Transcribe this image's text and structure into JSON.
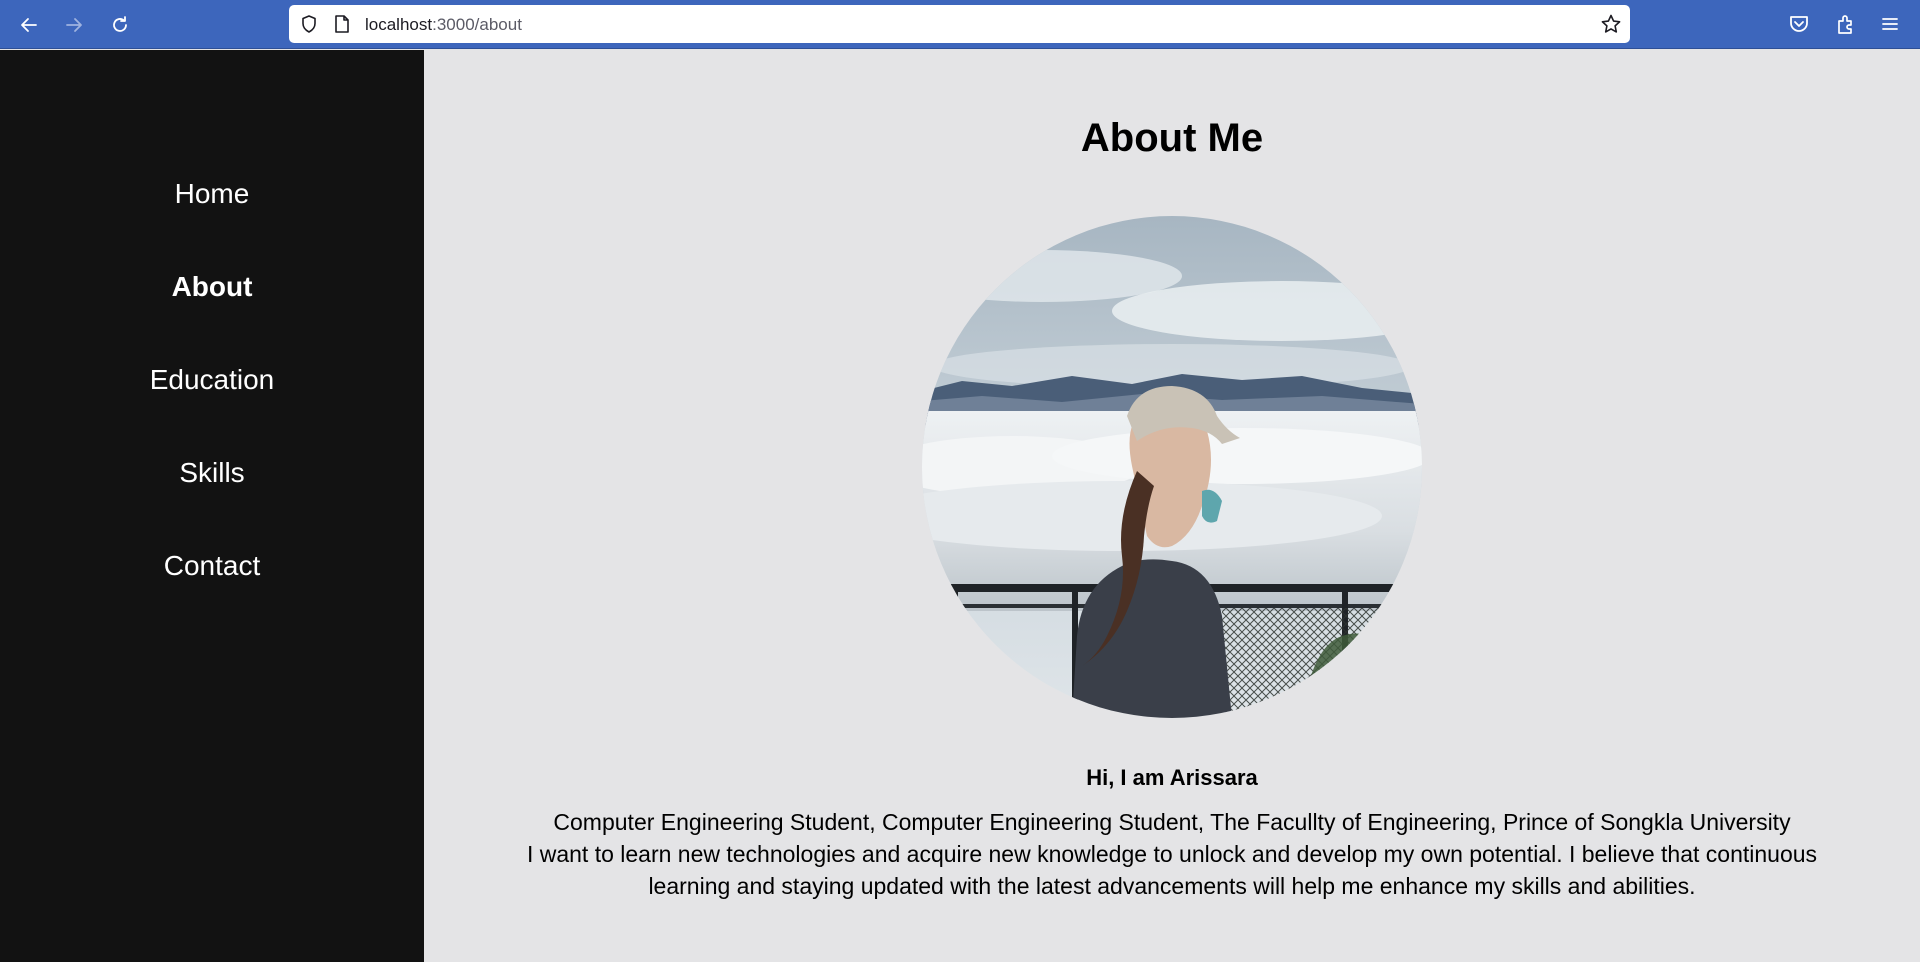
{
  "browser": {
    "url_host": "localhost",
    "url_path": ":3000/about",
    "icons": [
      "back-arrow-icon",
      "forward-arrow-icon",
      "reload-icon",
      "shield-icon",
      "page-icon",
      "star-icon",
      "pocket-icon",
      "extensions-icon",
      "hamburger-menu-icon"
    ]
  },
  "sidebar": {
    "items": [
      {
        "label": "Home",
        "active": false
      },
      {
        "label": "About",
        "active": true
      },
      {
        "label": "Education",
        "active": false
      },
      {
        "label": "Skills",
        "active": false
      },
      {
        "label": "Contact",
        "active": false
      }
    ]
  },
  "main": {
    "title": "About Me",
    "greeting": "Hi, I am Arissara",
    "bio_line_1": "Computer Engineering Student, Computer Engineering Student, The Facullty of Engineering, Prince of Songkla University",
    "bio_line_2": "I want to learn new technologies and acquire new knowledge to unlock and develop my own potential. I believe that continuous learning and staying updated with the latest advancements will help me enhance my skills and abilities."
  },
  "colors": {
    "browser_bar": "#3d66bc",
    "sidebar_bg": "#121212",
    "content_bg": "#e4e4e6"
  }
}
